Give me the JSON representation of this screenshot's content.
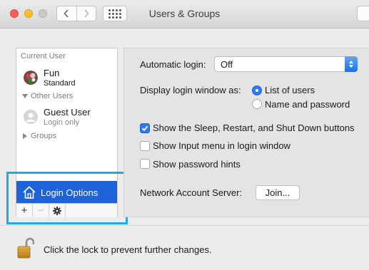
{
  "window": {
    "title": "Users & Groups"
  },
  "sidebar": {
    "current_user_header": "Current User",
    "current_user": {
      "name": "Fun",
      "role": "Standard"
    },
    "other_users_header": "Other Users",
    "guest_user": {
      "name": "Guest User",
      "status": "Login only"
    },
    "groups_label": "Groups",
    "login_options_label": "Login Options",
    "toolbar": {
      "add": "+",
      "remove": "−"
    }
  },
  "main": {
    "automatic_login_label": "Automatic login:",
    "automatic_login_value": "Off",
    "display_login_label": "Display login window as:",
    "display_options": [
      {
        "label": "List of users",
        "selected": true
      },
      {
        "label": "Name and password",
        "selected": false
      }
    ],
    "checkboxes": [
      {
        "label": "Show the Sleep, Restart, and Shut Down buttons",
        "checked": true
      },
      {
        "label": "Show Input menu in login window",
        "checked": false
      },
      {
        "label": "Show password hints",
        "checked": false
      }
    ],
    "network_server_label": "Network Account Server:",
    "join_button": "Join..."
  },
  "footer": {
    "lock_text": "Click the lock to prevent further changes."
  },
  "colors": {
    "selection_blue": "#1d62d8",
    "highlight_frame": "#20a8e0",
    "control_blue": "#2f7bef"
  },
  "icons": [
    "back-chevron-icon",
    "forward-chevron-icon",
    "grid-icon",
    "home-icon",
    "gear-icon",
    "lock-open-icon",
    "checkmark-icon"
  ]
}
